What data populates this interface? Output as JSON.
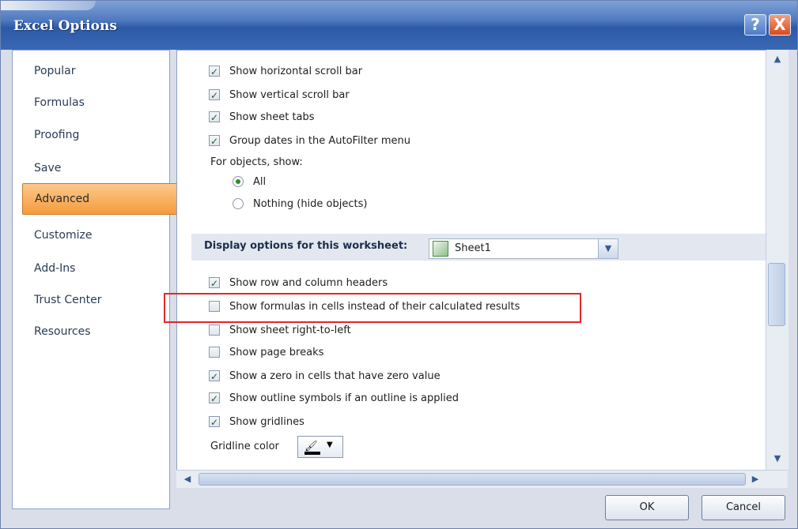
{
  "window": {
    "title": "Excel Options"
  },
  "titlebar_buttons": {
    "help": "?",
    "close": "X"
  },
  "sidebar": {
    "items": [
      {
        "label": "Popular"
      },
      {
        "label": "Formulas"
      },
      {
        "label": "Proofing"
      },
      {
        "label": "Save"
      },
      {
        "label": "Advanced",
        "active": true
      },
      {
        "label": "Customize"
      },
      {
        "label": "Add-Ins"
      },
      {
        "label": "Trust Center"
      },
      {
        "label": "Resources"
      }
    ]
  },
  "workbook_options": [
    {
      "label": "Show horizontal scroll bar",
      "checked": true
    },
    {
      "label": "Show vertical scroll bar",
      "checked": true
    },
    {
      "label": "Show sheet tabs",
      "checked": true
    },
    {
      "label": "Group dates in the AutoFilter menu",
      "checked": true
    }
  ],
  "objects": {
    "heading": "For objects, show:",
    "options": [
      {
        "label": "All",
        "selected": true
      },
      {
        "label": "Nothing (hide objects)",
        "selected": false
      }
    ]
  },
  "worksheet_section": {
    "label": "Display options for this worksheet:",
    "selected_sheet": "Sheet1"
  },
  "worksheet_options": [
    {
      "label": "Show row and column headers",
      "checked": true
    },
    {
      "label": "Show formulas in cells instead of their calculated results",
      "checked": false
    },
    {
      "label": "Show sheet right-to-left",
      "checked": false
    },
    {
      "label": "Show page breaks",
      "checked": false
    },
    {
      "label": "Show a zero in cells that have zero value",
      "checked": true
    },
    {
      "label": "Show outline symbols if an outline is applied",
      "checked": true
    },
    {
      "label": "Show gridlines",
      "checked": true
    }
  ],
  "gridline": {
    "label": "Gridline color"
  },
  "buttons": {
    "ok": "OK",
    "cancel": "Cancel"
  },
  "colors": {
    "highlight": "#e4262a",
    "active_nav": "#f59b3b",
    "titlebar": "#2d5aa6"
  }
}
